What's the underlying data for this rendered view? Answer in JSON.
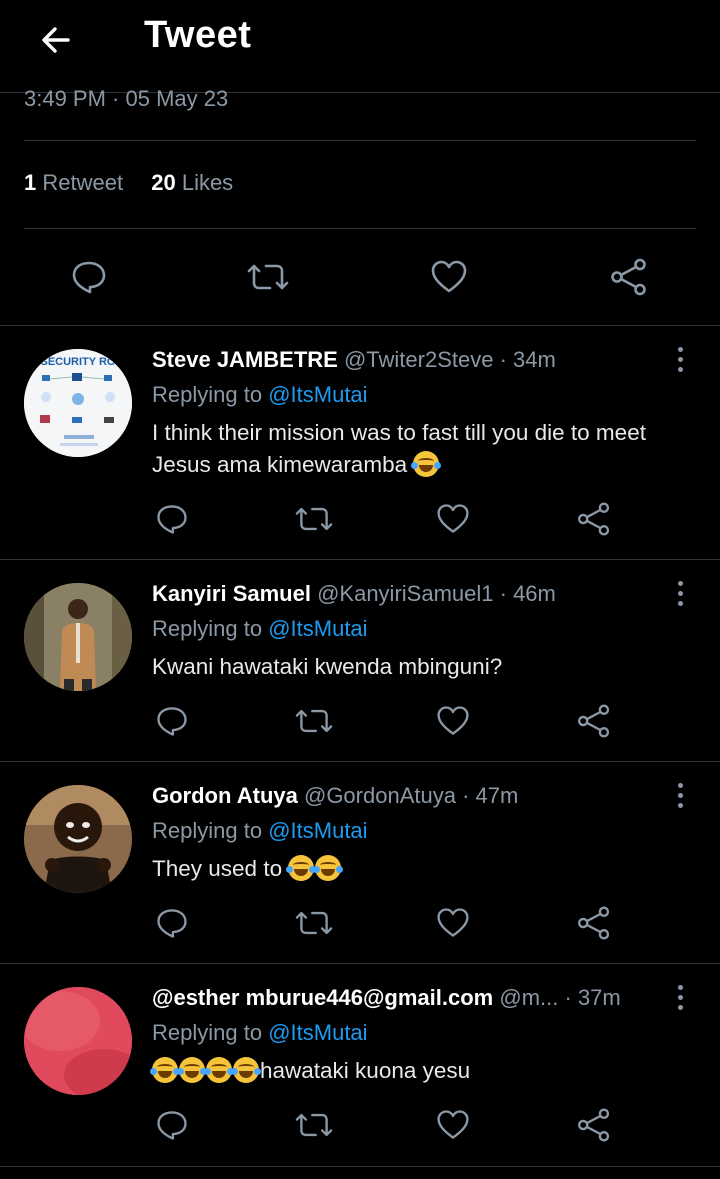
{
  "header": {
    "title": "Tweet"
  },
  "tweet": {
    "timestamp": "3:49 PM · 05 May 23",
    "retweets_count": "1",
    "retweets_label": "Retweet",
    "likes_count": "20",
    "likes_label": "Likes"
  },
  "replies": [
    {
      "name": "Steve JAMBETRE",
      "handle": "@Twiter2Steve",
      "time": "· 34m",
      "replying_prefix": "Replying to",
      "replying_to": "@ItsMutai",
      "text": "I think their mission was to fast till you die to meet Jesus ama kimewaramba",
      "emoji_count": 1,
      "avatar_colors": [
        "#ffffff",
        "#1c6fb8"
      ]
    },
    {
      "name": "Kanyiri Samuel",
      "handle": "@KanyiriSamuel1",
      "time": "· 46m",
      "replying_prefix": "Replying to",
      "replying_to": "@ItsMutai",
      "text": "Kwani hawataki kwenda mbinguni?",
      "emoji_count": 0,
      "avatar_colors": [
        "#7a6a4e",
        "#b07a45"
      ]
    },
    {
      "name": "Gordon Atuya",
      "handle": "@GordonAtuya",
      "time": "· 47m",
      "replying_prefix": "Replying to",
      "replying_to": "@ItsMutai",
      "text": "They used to",
      "emoji_count": 2,
      "avatar_colors": [
        "#4b2f1c",
        "#2a1a10"
      ]
    },
    {
      "name": "@esther mburue446@gmail.com",
      "handle": "@m...",
      "time": "· 37m",
      "replying_prefix": "Replying to",
      "replying_to": "@ItsMutai",
      "text": "hawataki kuona yesu",
      "emoji_count": 4,
      "avatar_colors": [
        "#e2465a",
        "#d03348"
      ]
    }
  ],
  "icons": [
    "back-arrow-icon",
    "reply-icon",
    "retweet-icon",
    "like-icon",
    "share-icon",
    "more-icon",
    "joy-emoji"
  ],
  "colors": {
    "background": "#000000",
    "link": "#1d9bf0",
    "secondary_text": "#8b98a5",
    "divider": "#2f3336"
  }
}
